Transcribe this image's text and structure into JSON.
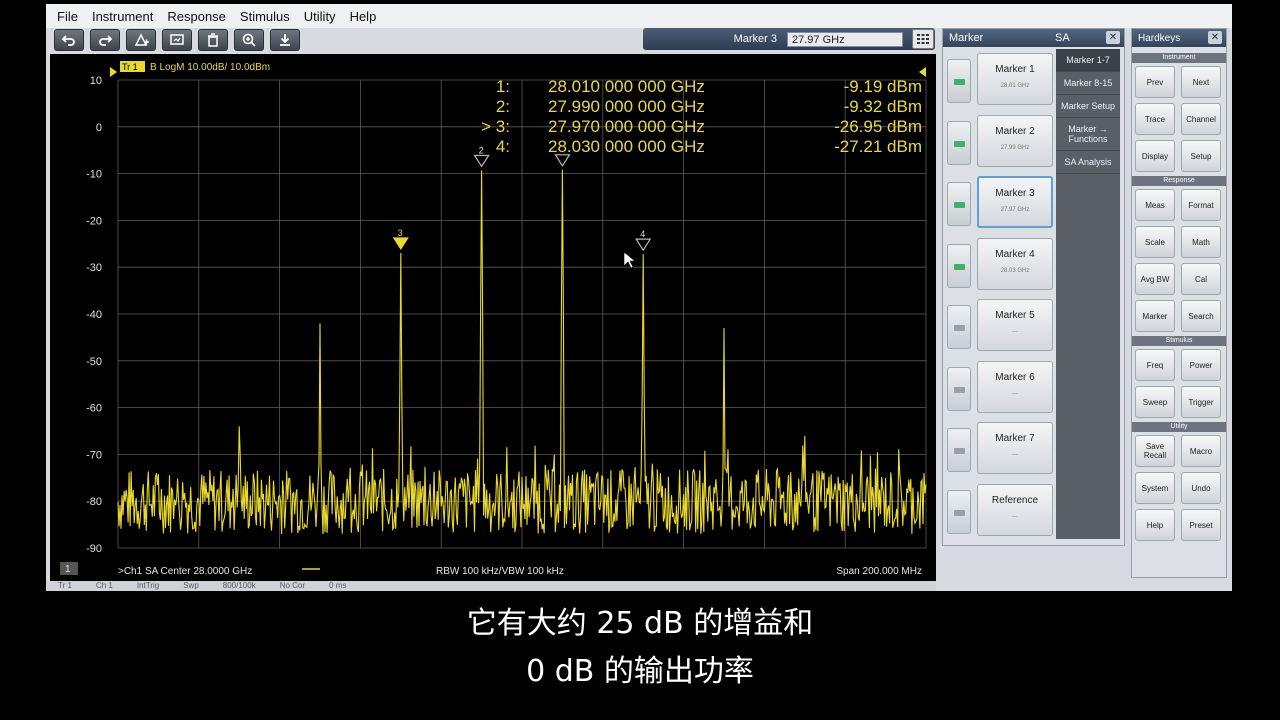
{
  "menu": [
    "File",
    "Instrument",
    "Response",
    "Stimulus",
    "Utility",
    "Help"
  ],
  "toolbar": [
    "undo-icon",
    "redo-icon",
    "marker-add-icon",
    "screenshot-icon",
    "trash-icon",
    "zoom-icon",
    "download-icon"
  ],
  "marker_entry": {
    "label": "Marker 3",
    "value": "27.97 GHz"
  },
  "trace_label": {
    "tag": "Tr 1",
    "text": "B LogM 10.00dB/ 10.0dBm"
  },
  "marker_table": [
    {
      "num": "1:",
      "freq": "28.010 000 000 GHz",
      "amp": "-9.19 dBm"
    },
    {
      "num": "2:",
      "freq": "27.990 000 000 GHz",
      "amp": "-9.32 dBm"
    },
    {
      "num": "> 3:",
      "freq": "27.970 000 000 GHz",
      "amp": "-26.95 dBm"
    },
    {
      "num": "4:",
      "freq": "28.030 000 000 GHz",
      "amp": "-27.21 dBm"
    }
  ],
  "footer": {
    "channel": "1",
    "left": ">Ch1  SA  Center  28.0000 GHz",
    "middle": "RBW  100 kHz/VBW  100 kHz",
    "right": "Span  200.000 MHz"
  },
  "status_bar": [
    "Tr 1",
    "Ch 1",
    "IntTrig",
    "Swp",
    "800/100k",
    "No Cor",
    "0 ms"
  ],
  "marker_panel": {
    "title": "Marker",
    "mode": "SA",
    "buttons": [
      {
        "label": "Marker 1",
        "sub": "28.01 GHz",
        "on": true
      },
      {
        "label": "Marker 2",
        "sub": "27.99 GHz",
        "on": true
      },
      {
        "label": "Marker 3",
        "sub": "27.97 GHz",
        "on": true,
        "active": true
      },
      {
        "label": "Marker 4",
        "sub": "28.03 GHz",
        "on": true
      },
      {
        "label": "Marker 5",
        "sub": "---",
        "on": false
      },
      {
        "label": "Marker 6",
        "sub": "---",
        "on": false
      },
      {
        "label": "Marker 7",
        "sub": "---",
        "on": false
      },
      {
        "label": "Reference",
        "sub": "---",
        "on": false
      }
    ],
    "side": [
      "Marker 1-7",
      "Marker 8-15",
      "Marker Setup",
      "Marker → Functions",
      "SA Analysis"
    ]
  },
  "hardkeys": {
    "title": "Hardkeys",
    "sections": [
      {
        "name": "Instrument",
        "keys": [
          "Prev",
          "Next",
          "Trace",
          "Channel",
          "Display",
          "Setup"
        ]
      },
      {
        "name": "Response",
        "keys": [
          "Meas",
          "Format",
          "Scale",
          "Math",
          "Avg BW",
          "Cal",
          "Marker",
          "Search"
        ]
      },
      {
        "name": "Stimulus",
        "keys": [
          "Freq",
          "Power",
          "Sweep",
          "Trigger"
        ]
      },
      {
        "name": "Utility",
        "keys": [
          "Save Recall",
          "Macro",
          "System",
          "Undo",
          "Help",
          "Preset"
        ]
      }
    ]
  },
  "subtitle": [
    "它有大约 25 dB 的增益和",
    "0 dB 的输出功率"
  ],
  "colors": {
    "trace": "#e8d92c",
    "grid": "#5b5b5b",
    "led_on": "#3fb06c",
    "led_off": "#9aa0a6"
  },
  "chart_data": {
    "type": "line",
    "ylim": [
      -90,
      10
    ],
    "y_ticks": [
      10,
      0,
      -10,
      -20,
      -30,
      -40,
      -50,
      -60,
      -70,
      -80,
      -90
    ],
    "x_range_ghz": [
      27.9,
      28.1
    ],
    "noise_floor_dbm": -80,
    "peaks": [
      {
        "freq_ghz": 27.95,
        "dbm": -42
      },
      {
        "freq_ghz": 27.97,
        "dbm": -26.95,
        "marker": "3"
      },
      {
        "freq_ghz": 27.99,
        "dbm": -9.32,
        "marker": "2"
      },
      {
        "freq_ghz": 28.01,
        "dbm": -9.19,
        "marker": "1"
      },
      {
        "freq_ghz": 28.03,
        "dbm": -27.21,
        "marker": "4"
      },
      {
        "freq_ghz": 28.05,
        "dbm": -43
      },
      {
        "freq_ghz": 27.93,
        "dbm": -64
      },
      {
        "freq_ghz": 28.07,
        "dbm": -66
      }
    ]
  }
}
